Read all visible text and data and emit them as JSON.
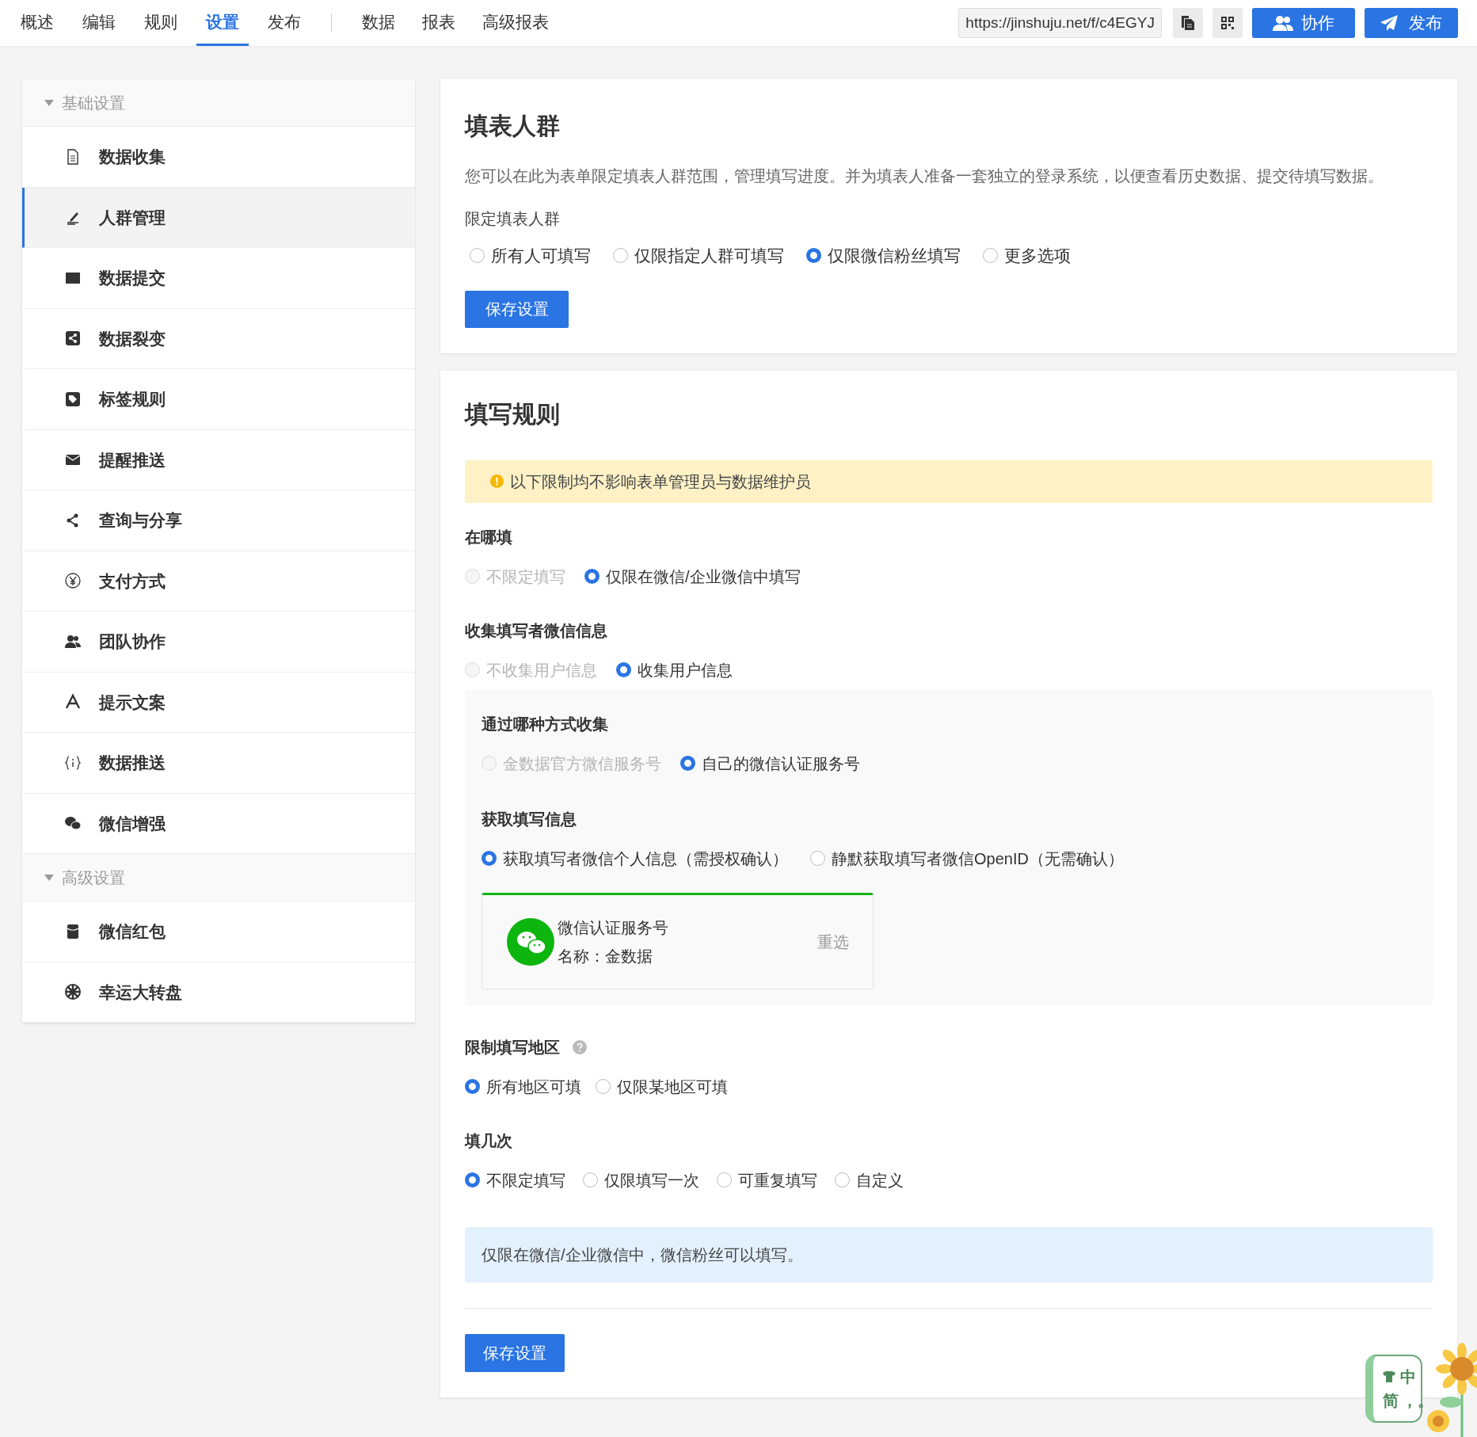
{
  "nav_tabs": [
    {
      "label": "概述",
      "selected": false
    },
    {
      "label": "编辑",
      "selected": false
    },
    {
      "label": "规则",
      "selected": false
    },
    {
      "label": "设置",
      "selected": true
    },
    {
      "label": "发布",
      "selected": false
    }
  ],
  "nav_tabs_2": [
    {
      "label": "数据",
      "selected": false
    },
    {
      "label": "报表",
      "selected": false
    },
    {
      "label": "高级报表",
      "selected": false
    }
  ],
  "toolbar": {
    "url": "https://jinshuju.net/f/c4EGYJ",
    "buttons": [
      "协作",
      "发布"
    ]
  },
  "sidebar": {
    "sections": [
      {
        "title": "基础设置",
        "expanded": true,
        "items": [
          {
            "label": "数据收集",
            "selected": false
          },
          {
            "label": "人群管理",
            "selected": true
          },
          {
            "label": "数据提交",
            "selected": false
          },
          {
            "label": "数据裂变",
            "selected": false
          },
          {
            "label": "标签规则",
            "selected": false
          },
          {
            "label": "提醒推送",
            "selected": false
          },
          {
            "label": "查询与分享",
            "selected": false
          },
          {
            "label": "支付方式",
            "selected": false
          },
          {
            "label": "团队协作",
            "selected": false
          },
          {
            "label": "提示文案",
            "selected": false
          },
          {
            "label": "数据推送",
            "selected": false
          },
          {
            "label": "微信增强",
            "selected": false
          }
        ]
      },
      {
        "title": "高级设置",
        "expanded": true,
        "items": [
          {
            "label": "微信红包",
            "selected": false
          },
          {
            "label": "幸运大转盘",
            "selected": false
          }
        ]
      }
    ]
  },
  "audience_card": {
    "title": "填表人群",
    "description": "您可以在此为表单限定填表人群范围，管理填写进度。并为填表人准备一套独立的登录系统，以便查看历史数据、提交待填写数据。",
    "field_label": "限定填表人群",
    "options": [
      {
        "label": "所有人可填写",
        "selected": false,
        "disabled": false
      },
      {
        "label": "仅限指定人群可填写",
        "selected": false,
        "disabled": false
      },
      {
        "label": "仅限微信粉丝填写",
        "selected": true,
        "disabled": false
      },
      {
        "label": "更多选项",
        "selected": false,
        "disabled": false
      }
    ],
    "save_button": "保存设置"
  },
  "rules_card": {
    "title": "填写规则",
    "notice": "以下限制均不影响表单管理员与数据维护员",
    "where": {
      "label": "在哪填",
      "options": [
        {
          "label": "不限定填写",
          "selected": false,
          "disabled": true
        },
        {
          "label": "仅限在微信/企业微信中填写",
          "selected": true,
          "disabled": false
        }
      ]
    },
    "collect": {
      "label": "收集填写者微信信息",
      "options": [
        {
          "label": "不收集用户信息",
          "selected": false,
          "disabled": true
        },
        {
          "label": "收集用户信息",
          "selected": true,
          "disabled": false
        }
      ],
      "method": {
        "label": "通过哪种方式收集",
        "options": [
          {
            "label": "金数据官方微信服务号",
            "selected": false,
            "disabled": true
          },
          {
            "label": "自己的微信认证服务号",
            "selected": true,
            "disabled": false
          }
        ]
      },
      "fetch": {
        "label": "获取填写信息",
        "options": [
          {
            "label": "获取填写者微信个人信息（需授权确认）",
            "selected": true,
            "disabled": false
          },
          {
            "label": "静默获取填写者微信OpenID（无需确认）",
            "selected": false,
            "disabled": false
          }
        ]
      },
      "account": {
        "title": "微信认证服务号",
        "name": "名称：金数据",
        "action": "重选"
      }
    },
    "region": {
      "label": "限制填写地区",
      "options": [
        {
          "label": "所有地区可填",
          "selected": true,
          "disabled": false
        },
        {
          "label": "仅限某地区可填",
          "selected": false,
          "disabled": false
        }
      ]
    },
    "times": {
      "label": "填几次",
      "options": [
        {
          "label": "不限定填写",
          "selected": true,
          "disabled": false
        },
        {
          "label": "仅限填写一次",
          "selected": false,
          "disabled": false
        },
        {
          "label": "可重复填写",
          "selected": false,
          "disabled": false
        },
        {
          "label": "自定义",
          "selected": false,
          "disabled": false
        }
      ]
    },
    "summary": "仅限在微信/企业微信中，微信粉丝可以填写。",
    "save_button": "保存设置"
  },
  "ime_widget": {
    "mode": "中",
    "script": "简",
    "punctuation": "，。"
  }
}
